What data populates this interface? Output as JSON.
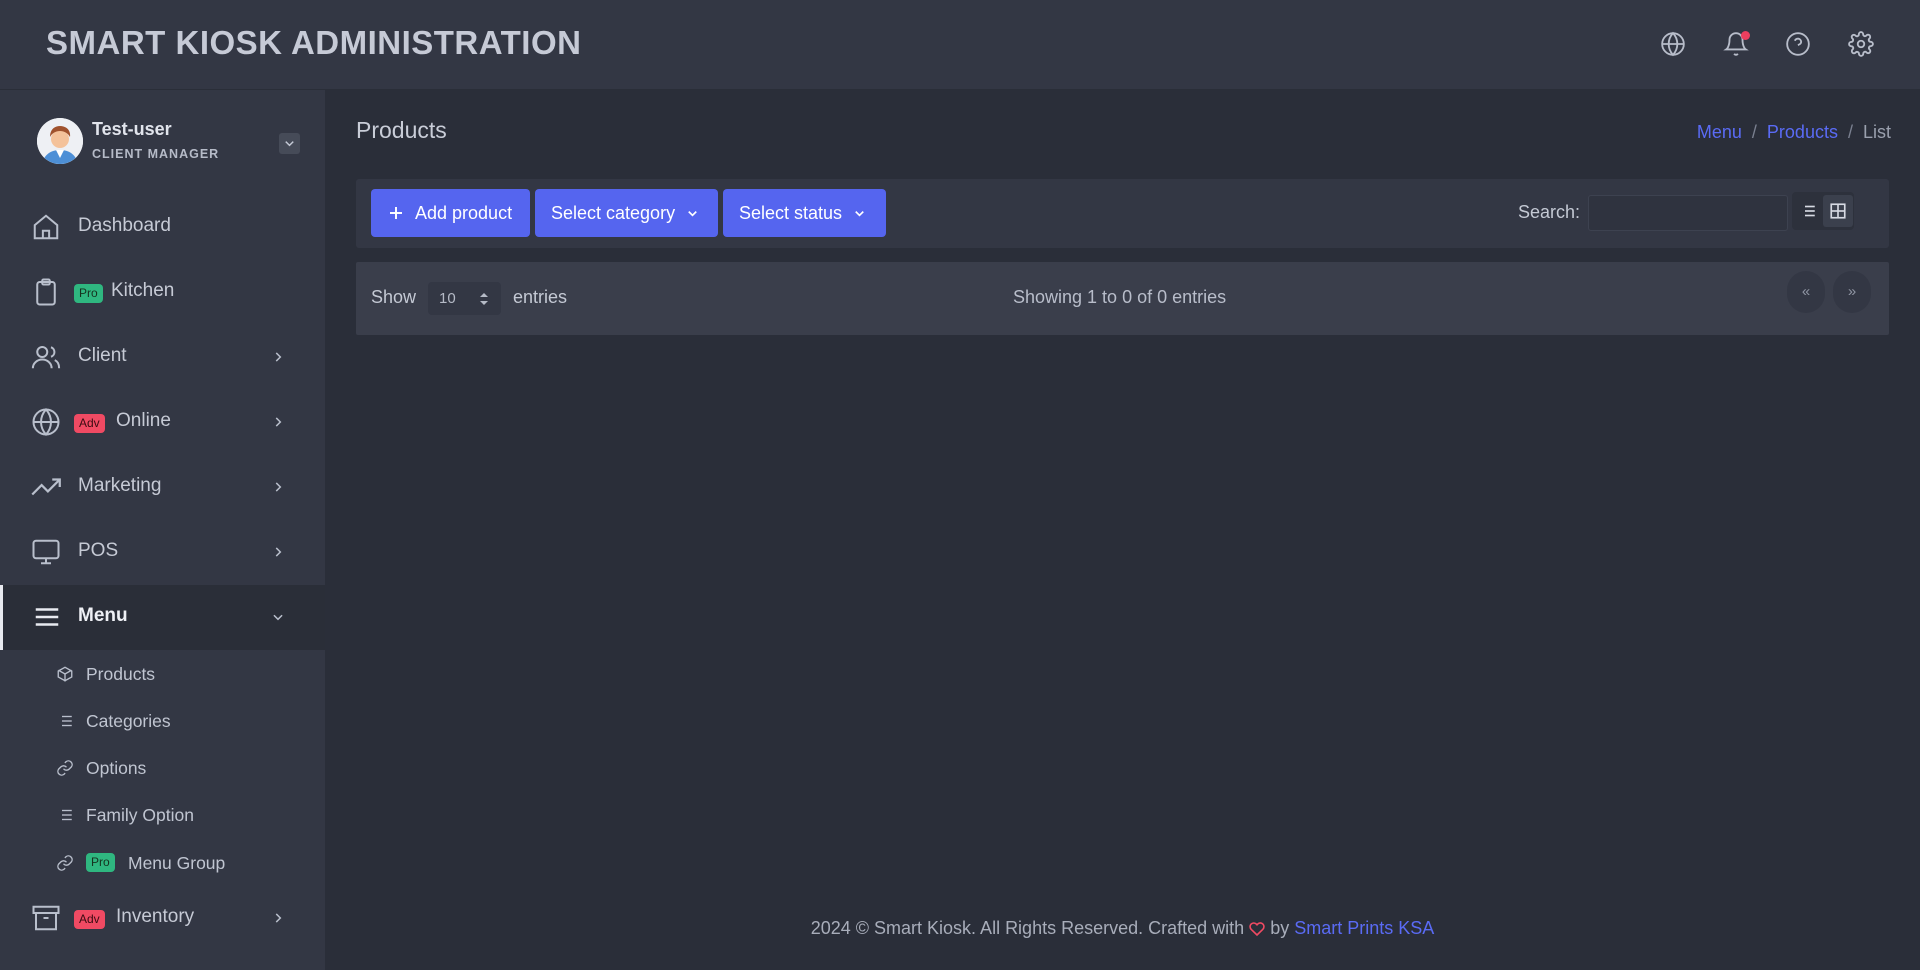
{
  "header": {
    "title": "SMART KIOSK ADMINISTRATION",
    "icons": [
      "globe-icon",
      "bell-icon",
      "help-icon",
      "gear-icon"
    ]
  },
  "user": {
    "name": "Test-user",
    "role": "CLIENT MANAGER"
  },
  "sidebar": {
    "items": [
      {
        "label": "Dashboard",
        "icon": "home-icon"
      },
      {
        "label": "Kitchen",
        "badge": "Pro",
        "icon": "clipboard-icon"
      },
      {
        "label": "Client",
        "icon": "users-icon"
      },
      {
        "label": "Online",
        "badge": "Adv",
        "icon": "globe-icon"
      },
      {
        "label": "Marketing",
        "icon": "trending-up-icon"
      },
      {
        "label": "POS",
        "icon": "monitor-icon"
      },
      {
        "label": "Menu",
        "icon": "menu-icon",
        "expanded": true
      },
      {
        "label": "Inventory",
        "badge": "Adv",
        "icon": "archive-icon"
      }
    ],
    "menu_sub_items": [
      {
        "label": "Products",
        "icon": "box-icon"
      },
      {
        "label": "Categories",
        "icon": "list-icon"
      },
      {
        "label": "Options",
        "icon": "link-icon"
      },
      {
        "label": "Family Option",
        "icon": "list-icon"
      },
      {
        "label": "Menu Group",
        "badge": "Pro",
        "icon": "link-icon"
      }
    ]
  },
  "page": {
    "title": "Products",
    "breadcrumb": [
      "Menu",
      "Products",
      "List"
    ]
  },
  "toolbar": {
    "add_label": "Add product",
    "category_label": "Select category",
    "status_label": "Select status",
    "search_label": "Search:",
    "search_value": ""
  },
  "table": {
    "show_label": "Show",
    "entries_value": "10",
    "entries_label": "entries",
    "info": "Showing 1 to 0 of 0 entries",
    "prev": "«",
    "next": "»"
  },
  "footer": {
    "text_before": "2024 © Smart Kiosk. All Rights Reserved. Crafted with",
    "text_by": "by",
    "link": "Smart Prints KSA"
  },
  "colors": {
    "accent": "#5565ef",
    "pro_badge": "#2fb780",
    "adv_badge": "#f04a63"
  }
}
